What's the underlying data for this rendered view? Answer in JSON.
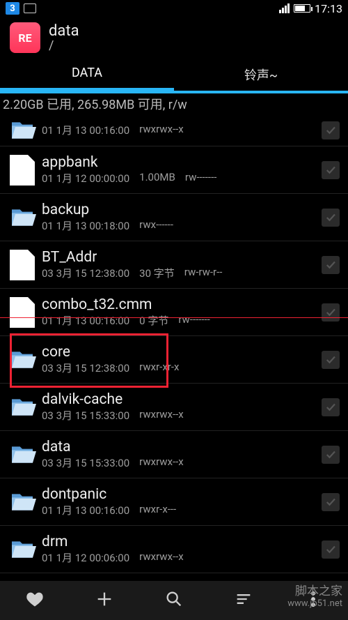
{
  "status": {
    "notif_count": "3",
    "time": "17:13"
  },
  "app": {
    "icon_label": "RE",
    "title": "data",
    "path": "/"
  },
  "tabs": {
    "active": "DATA",
    "other": "铃声~"
  },
  "storage_line": "2.20GB 已用, 265.98MB 可用, r/w",
  "items": [
    {
      "name": "",
      "date": "01 1月 13 00:16:00",
      "extra": "",
      "perm": "rwxrwx--x",
      "type": "folder"
    },
    {
      "name": "appbank",
      "date": "01 1月 12 00:00:00",
      "extra": "1.00MB",
      "perm": "rw-------",
      "type": "file"
    },
    {
      "name": "backup",
      "date": "01 1月 13 00:18:00",
      "extra": "",
      "perm": "rwx------",
      "type": "folder"
    },
    {
      "name": "BT_Addr",
      "date": "03 3月 15 12:38:00",
      "extra": "30 字节",
      "perm": "rw-rw-r--",
      "type": "file"
    },
    {
      "name": "combo_t32.cmm",
      "date": "01 1月 13 00:16:00",
      "extra": "0 字节",
      "perm": "rw-------",
      "type": "file"
    },
    {
      "name": "core",
      "date": "03 3月 15 12:38:00",
      "extra": "",
      "perm": "rwxr-xr-x",
      "type": "folder"
    },
    {
      "name": "dalvik-cache",
      "date": "03 3月 15 15:33:00",
      "extra": "",
      "perm": "rwxrwx--x",
      "type": "folder"
    },
    {
      "name": "data",
      "date": "03 3月 15 15:33:00",
      "extra": "",
      "perm": "rwxrwx--x",
      "type": "folder"
    },
    {
      "name": "dontpanic",
      "date": "01 1月 13 00:16:00",
      "extra": "",
      "perm": "rwxr-x---",
      "type": "folder"
    },
    {
      "name": "drm",
      "date": "01 1月 12 00:06:00",
      "extra": "",
      "perm": "rwxrwx--x",
      "type": "folder"
    }
  ],
  "watermark": {
    "name": "脚本之家",
    "url": "www.jb51.net"
  }
}
